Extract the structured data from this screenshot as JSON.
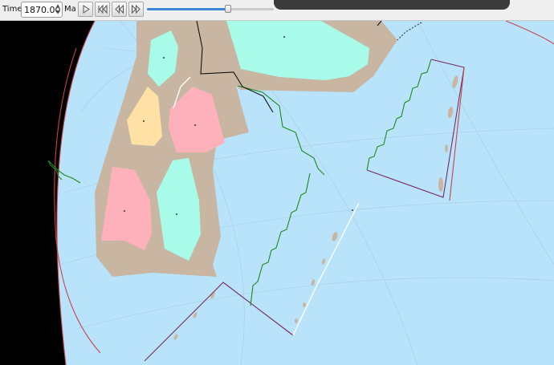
{
  "toolbar": {
    "time_label": "Time:",
    "time_value": "1870.00",
    "units_label": "Ma",
    "buttons": [
      {
        "name": "play-button",
        "icon": "play-icon"
      },
      {
        "name": "rewind-to-start-button",
        "icon": "skip-to-start-icon"
      },
      {
        "name": "step-back-button",
        "icon": "step-back-icon"
      },
      {
        "name": "step-forward-button",
        "icon": "step-forward-icon"
      }
    ],
    "slider": {
      "fraction": 0.64
    }
  },
  "colors": {
    "ocean": "#b9e3fb",
    "space": "#000000",
    "crust": "#c8b6a3",
    "terrane_green": "#a8fbe9",
    "terrane_pink": "#ffb1bb",
    "terrane_yellow": "#ffe1a6",
    "ridge": "#1b8a1b",
    "subduction": "#7a2a5e",
    "boundary_red": "#c8424a",
    "boundary_black": "#111111",
    "boundary_white": "#ffffff"
  }
}
